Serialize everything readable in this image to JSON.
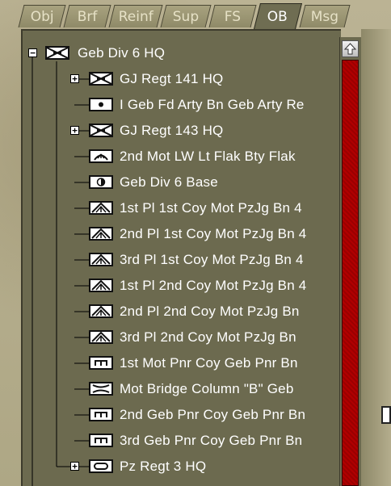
{
  "tabs": [
    "Obj",
    "Brf",
    "Reinf",
    "Sup",
    "FS",
    "OB",
    "Msg"
  ],
  "active_tab": "OB",
  "tree": [
    {
      "label": "Geb Div 6 HQ",
      "icon": "hq-infantry-icon",
      "expander": "−",
      "level": 0
    },
    {
      "label": "GJ Regt 141 HQ",
      "icon": "hq-infantry-icon",
      "expander": "+",
      "level": 1
    },
    {
      "label": "I Geb Fd Arty Bn Geb Arty Re",
      "icon": "artillery-icon",
      "expander": "",
      "level": 1
    },
    {
      "label": "GJ Regt 143 HQ",
      "icon": "hq-infantry-icon",
      "expander": "+",
      "level": 1
    },
    {
      "label": "2nd Mot LW Lt Flak Bty Flak",
      "icon": "flak-icon",
      "expander": "",
      "level": 1
    },
    {
      "label": "Geb Div 6 Base",
      "icon": "base-icon",
      "expander": "",
      "level": 1
    },
    {
      "label": "1st Pl 1st Coy Mot PzJg Bn 4",
      "icon": "antitank-icon",
      "expander": "",
      "level": 1
    },
    {
      "label": "2nd Pl 1st Coy Mot PzJg Bn 4",
      "icon": "antitank-icon",
      "expander": "",
      "level": 1
    },
    {
      "label": "3rd Pl 1st Coy Mot PzJg Bn 4",
      "icon": "antitank-icon",
      "expander": "",
      "level": 1
    },
    {
      "label": "1st Pl 2nd Coy Mot PzJg Bn 4",
      "icon": "antitank-icon",
      "expander": "",
      "level": 1
    },
    {
      "label": "2nd Pl 2nd Coy Mot PzJg Bn",
      "icon": "antitank-icon",
      "expander": "",
      "level": 1
    },
    {
      "label": "3rd Pl 2nd Coy Mot PzJg Bn",
      "icon": "antitank-icon",
      "expander": "",
      "level": 1
    },
    {
      "label": "1st Mot Pnr Coy Geb Pnr Bn",
      "icon": "engineer-icon",
      "expander": "",
      "level": 1
    },
    {
      "label": "Mot Bridge Column \"B\" Geb",
      "icon": "bridge-icon",
      "expander": "",
      "level": 1
    },
    {
      "label": "2nd Geb Pnr Coy Geb Pnr Bn",
      "icon": "engineer-icon",
      "expander": "",
      "level": 1
    },
    {
      "label": "3rd Geb Pnr Coy Geb Pnr Bn",
      "icon": "engineer-icon",
      "expander": "",
      "level": 1
    },
    {
      "label": "Pz Regt 3 HQ",
      "icon": "armor-icon",
      "expander": "+",
      "level": 1
    }
  ],
  "scrollbar": {
    "up_icon": "arrow-up-icon",
    "track_color": "#a80000"
  }
}
